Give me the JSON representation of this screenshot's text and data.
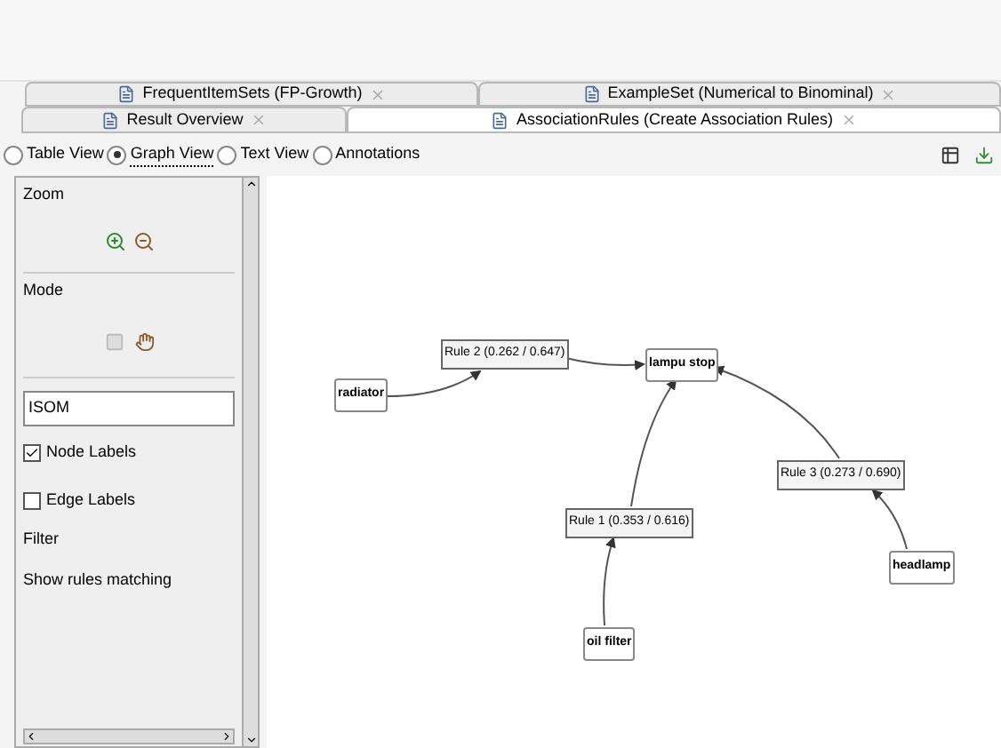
{
  "tabs_back": [
    {
      "label": "FrequentItemSets (FP-Growth)",
      "selected": false
    },
    {
      "label": "ExampleSet (Numerical to Binominal)",
      "selected": false
    }
  ],
  "tabs_front": [
    {
      "label": "Result Overview",
      "selected": false
    },
    {
      "label": "AssociationRules (Create Association Rules)",
      "selected": true
    }
  ],
  "views": [
    {
      "label": "Table View",
      "selected": false
    },
    {
      "label": "Graph View",
      "selected": true
    },
    {
      "label": "Text View",
      "selected": false
    },
    {
      "label": "Annotations",
      "selected": false
    }
  ],
  "sidebar": {
    "zoom_title": "Zoom",
    "mode_title": "Mode",
    "layout_field": "ISOM",
    "options": [
      {
        "label": "Node Labels",
        "checked": true
      },
      {
        "label": "Edge Labels",
        "checked": false
      }
    ],
    "filter_title": "Filter",
    "filter_label": "Show rules matching"
  },
  "graph": {
    "items": [
      {
        "label": "radiator"
      },
      {
        "label": "lampu stop"
      },
      {
        "label": "oil filter"
      },
      {
        "label": "headlamp"
      }
    ],
    "rules": [
      {
        "label": "Rule 2 (0.262 / 0.647)"
      },
      {
        "label": "Rule 1 (0.353 / 0.616)"
      },
      {
        "label": "Rule 3 (0.273 / 0.690)"
      }
    ]
  }
}
